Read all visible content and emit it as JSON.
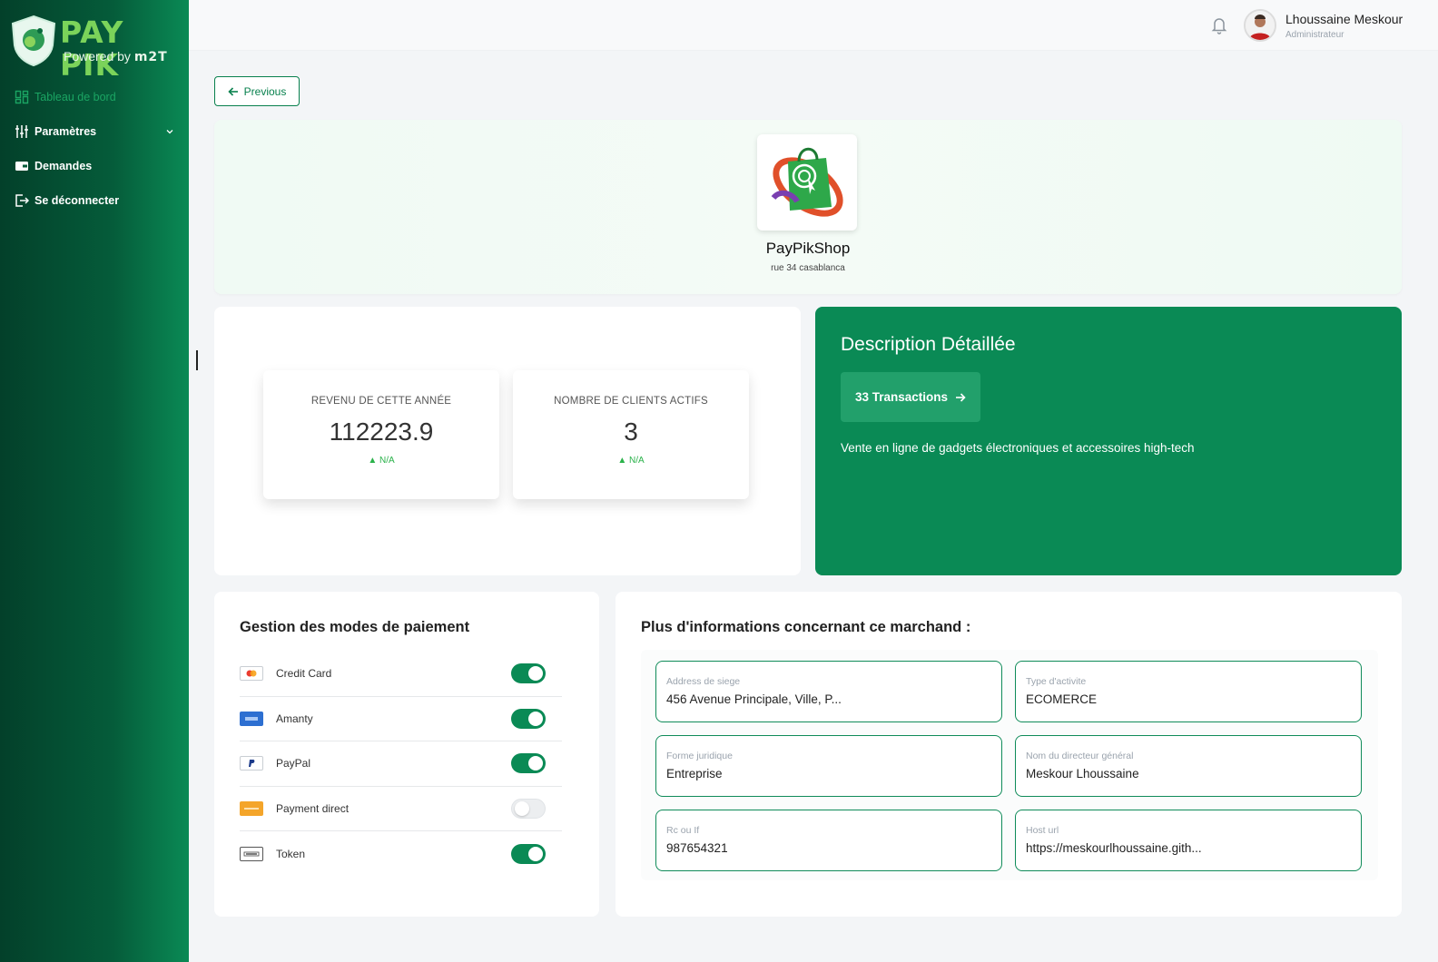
{
  "brand": {
    "name": "PAY PIK",
    "powered_by": "Powered by",
    "powered_brand": "m2T"
  },
  "sidebar": {
    "items": [
      {
        "label": "Tableau de bord",
        "icon": "dashboard-icon"
      },
      {
        "label": "Paramètres",
        "icon": "sliders-icon"
      },
      {
        "label": "Demandes",
        "icon": "wallet-icon"
      },
      {
        "label": "Se déconnecter",
        "icon": "logout-icon"
      }
    ]
  },
  "header": {
    "user_name": "Lhoussaine Meskour",
    "user_role": "Administrateur"
  },
  "nav_back": {
    "label": "Previous"
  },
  "shop": {
    "logo_text": "PayPik Shop",
    "name": "PayPikShop",
    "address": "rue 34 casablanca"
  },
  "stats": [
    {
      "label": "REVENU DE CETTE ANNÉE",
      "value": "112223.9",
      "trend": "▲ N/A"
    },
    {
      "label": "NOMBRE DE CLIENTS ACTIFS",
      "value": "3",
      "trend": "▲ N/A"
    }
  ],
  "description": {
    "title": "Description Détaillée",
    "transactions_label": "33 Transactions",
    "text": "Vente en ligne de gadgets électroniques et accessoires high-tech"
  },
  "payment_modes": {
    "title": "Gestion des modes de paiement",
    "items": [
      {
        "name": "Credit Card",
        "icon": "credit-card-icon",
        "enabled": true
      },
      {
        "name": "Amanty",
        "icon": "amanty-icon",
        "enabled": true
      },
      {
        "name": "PayPal",
        "icon": "paypal-icon",
        "enabled": true
      },
      {
        "name": "Payment direct",
        "icon": "payment-direct-icon",
        "enabled": false
      },
      {
        "name": "Token",
        "icon": "token-icon",
        "enabled": true
      }
    ]
  },
  "merchant_info": {
    "title": "Plus d'informations concernant ce marchand :",
    "fields": [
      {
        "label": "Address de siege",
        "value": "456 Avenue Principale, Ville, P..."
      },
      {
        "label": "Type d'activite",
        "value": "ECOMERCE"
      },
      {
        "label": "Forme juridique",
        "value": "Entreprise"
      },
      {
        "label": "Nom du directeur général",
        "value": "Meskour Lhoussaine"
      },
      {
        "label": "Rc ou If",
        "value": "987654321"
      },
      {
        "label": "Host url",
        "value": "https://meskourlhoussaine.gith..."
      }
    ]
  },
  "colors": {
    "primary": "#0a8a55",
    "sidebar_dark": "#03402a",
    "toggle_on": "#0a8a55",
    "trend_green": "#2ab24a"
  }
}
